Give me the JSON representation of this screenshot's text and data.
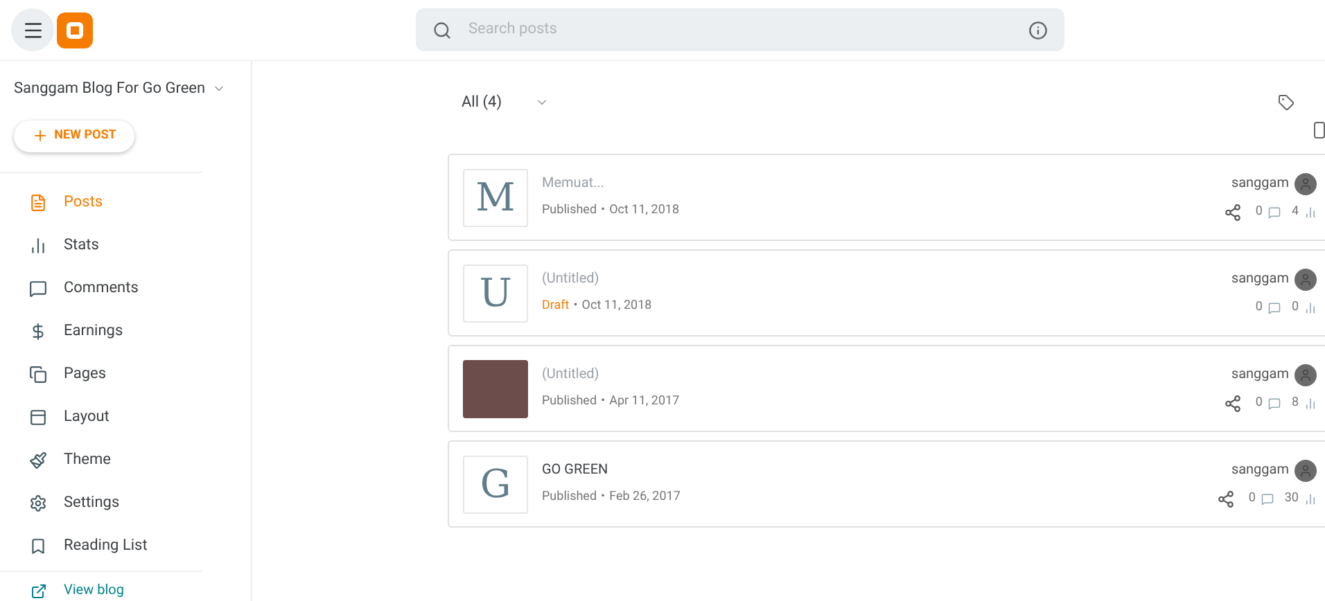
{
  "search": {
    "placeholder": "Search posts"
  },
  "blog_selector": {
    "label": "Sanggam Blog For Go Green"
  },
  "new_post_button": {
    "label": "NEW POST"
  },
  "sidebar": {
    "items": [
      {
        "label": "Posts",
        "selected": true
      },
      {
        "label": "Stats",
        "selected": false
      },
      {
        "label": "Comments",
        "selected": false
      },
      {
        "label": "Earnings",
        "selected": false
      },
      {
        "label": "Pages",
        "selected": false
      },
      {
        "label": "Layout",
        "selected": false
      },
      {
        "label": "Theme",
        "selected": false
      },
      {
        "label": "Settings",
        "selected": false
      },
      {
        "label": "Reading List",
        "selected": false
      }
    ],
    "view_blog": "View blog"
  },
  "filter": {
    "label": "All (4)"
  },
  "select_all": {
    "checked": false
  },
  "posts": [
    {
      "kind": "letter",
      "letter": "M",
      "title": "Memuat...",
      "title_muted": true,
      "status": "Published",
      "draft": false,
      "separator": "•",
      "date": "Oct 11, 2018",
      "author": "sanggam",
      "shareable": true,
      "comments": "0",
      "views": "4"
    },
    {
      "kind": "letter",
      "letter": "U",
      "title": "(Untitled)",
      "title_muted": true,
      "status": "Draft",
      "draft": true,
      "separator": "•",
      "date": "Oct 11, 2018",
      "author": "sanggam",
      "shareable": false,
      "comments": "0",
      "views": "0"
    },
    {
      "kind": "photo",
      "title": "(Untitled)",
      "title_muted": true,
      "status": "Published",
      "draft": false,
      "separator": "•",
      "date": "Apr 11, 2017",
      "author": "sanggam",
      "shareable": true,
      "comments": "0",
      "views": "8"
    },
    {
      "kind": "letter",
      "letter": "G",
      "title": "GO GREEN",
      "title_muted": false,
      "status": "Published",
      "draft": false,
      "separator": "•",
      "date": "Feb 26, 2017",
      "author": "sanggam",
      "shareable": true,
      "comments": "0",
      "views": "30"
    }
  ]
}
